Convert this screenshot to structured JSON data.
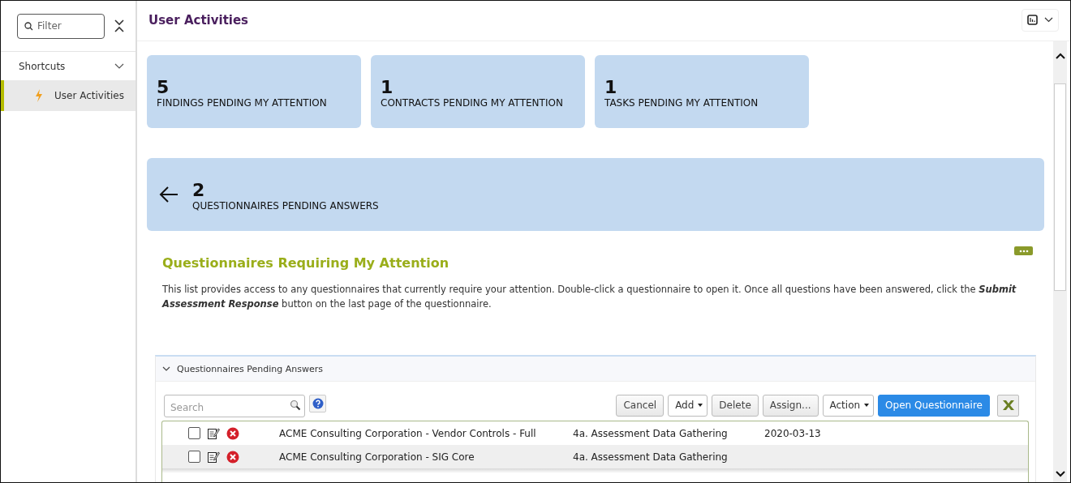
{
  "sidebar": {
    "filter": {
      "placeholder": "Filter"
    },
    "section": {
      "label": "Shortcuts",
      "expanded": true
    },
    "items": [
      {
        "label": "User Activities",
        "selected": true
      }
    ]
  },
  "header": {
    "title": "User Activities"
  },
  "cards": [
    {
      "count": "5",
      "label": "FINDINGS PENDING MY ATTENTION"
    },
    {
      "count": "1",
      "label": "CONTRACTS PENDING MY ATTENTION"
    },
    {
      "count": "1",
      "label": "TASKS PENDING MY ATTENTION"
    }
  ],
  "open_card": {
    "count": "2",
    "label": "QUESTIONNAIRES PENDING ANSWERS"
  },
  "section": {
    "title": "Questionnaires Requiring My Attention",
    "description": "This list provides access to any questionnaires that currently require your attention. Double-click a questionnaire to open it. Once all questions have been answered, click the **Submit Assessment Response** button on the last page of the questionnaire."
  },
  "panel": {
    "title": "Questionnaires Pending Answers",
    "expanded": true,
    "search": {
      "placeholder": "Search"
    },
    "buttons": [
      {
        "label": "Cancel",
        "kind": "plain"
      },
      {
        "label": "Add",
        "kind": "dropdown"
      },
      {
        "label": "Delete",
        "kind": "plain"
      },
      {
        "label": "Assign...",
        "kind": "plain"
      },
      {
        "label": "Action",
        "kind": "dropdown"
      },
      {
        "label": "Open Questionnaire",
        "kind": "primary"
      }
    ],
    "rows": [
      {
        "checked": false,
        "selected": false,
        "name": "ACME Consulting Corporation - Vendor Controls - Full",
        "stage": "4a. Assessment Data Gathering",
        "date": "2020-03-13"
      },
      {
        "checked": false,
        "selected": true,
        "name": "ACME Consulting Corporation - SIG Core",
        "stage": "4a. Assessment Data Gathering"
      }
    ]
  }
}
